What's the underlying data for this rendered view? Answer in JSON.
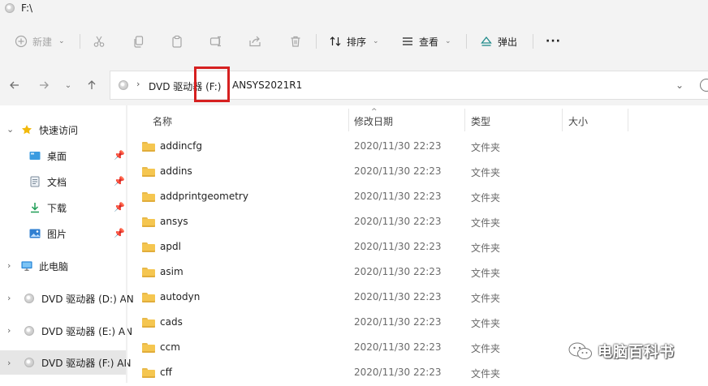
{
  "window": {
    "title": "F:\\"
  },
  "toolbar": {
    "new_label": "新建",
    "sort_label": "排序",
    "view_label": "查看",
    "eject_label": "弹出",
    "more_label": "···"
  },
  "address": {
    "root": "DVD 驱动器 (F:)",
    "folder": "ANSYS2021R1"
  },
  "sidebar": {
    "quick_access": "快速访问",
    "items": [
      {
        "label": "桌面",
        "icon": "desktop-icon"
      },
      {
        "label": "文档",
        "icon": "document-icon"
      },
      {
        "label": "下载",
        "icon": "download-icon"
      },
      {
        "label": "图片",
        "icon": "pictures-icon"
      }
    ],
    "this_pc": "此电脑",
    "drives": [
      {
        "label": "DVD 驱动器 (D:) AN"
      },
      {
        "label": "DVD 驱动器 (E:) AN"
      },
      {
        "label": "DVD 驱动器 (F:) AN"
      }
    ]
  },
  "columns": {
    "name": "名称",
    "date": "修改日期",
    "type": "类型",
    "size": "大小"
  },
  "files": [
    {
      "name": "addincfg",
      "date": "2020/11/30 22:23",
      "type": "文件夹"
    },
    {
      "name": "addins",
      "date": "2020/11/30 22:23",
      "type": "文件夹"
    },
    {
      "name": "addprintgeometry",
      "date": "2020/11/30 22:23",
      "type": "文件夹"
    },
    {
      "name": "ansys",
      "date": "2020/11/30 22:23",
      "type": "文件夹"
    },
    {
      "name": "apdl",
      "date": "2020/11/30 22:23",
      "type": "文件夹"
    },
    {
      "name": "asim",
      "date": "2020/11/30 22:23",
      "type": "文件夹"
    },
    {
      "name": "autodyn",
      "date": "2020/11/30 22:23",
      "type": "文件夹"
    },
    {
      "name": "cads",
      "date": "2020/11/30 22:23",
      "type": "文件夹"
    },
    {
      "name": "ccm",
      "date": "2020/11/30 22:23",
      "type": "文件夹"
    },
    {
      "name": "cff",
      "date": "2020/11/30 22:23",
      "type": "文件夹"
    }
  ],
  "watermark": {
    "text": "电脑百科书"
  }
}
